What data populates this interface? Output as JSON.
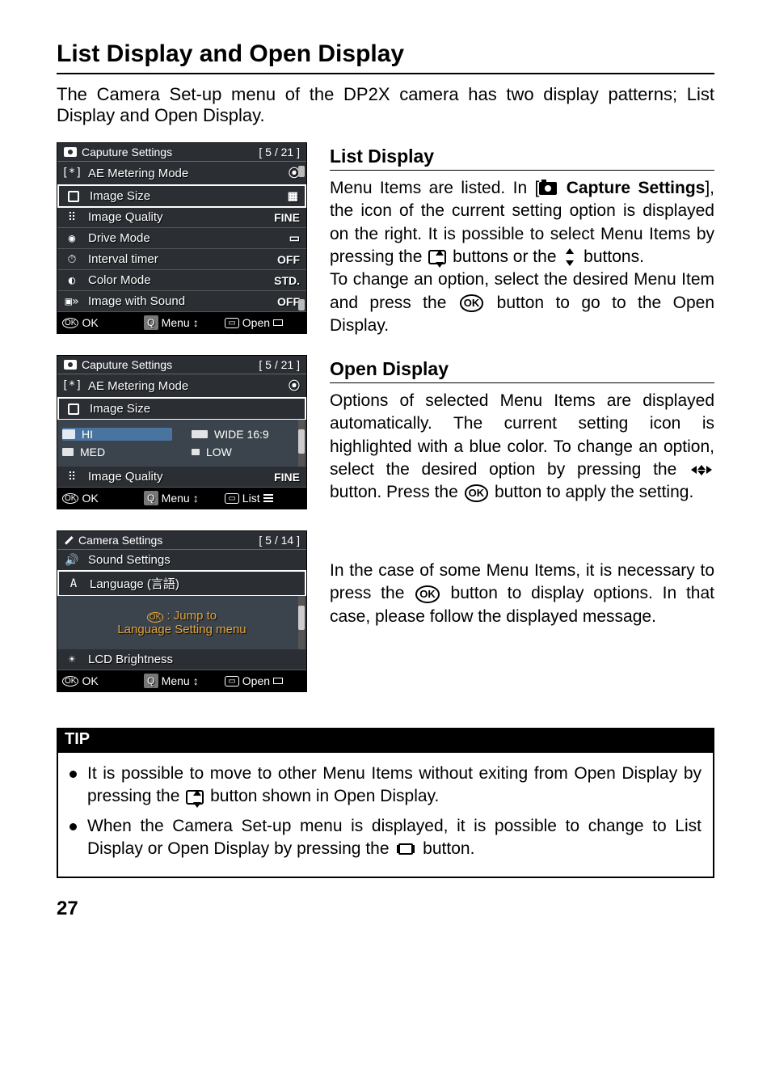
{
  "page_title": "List Display and Open Display",
  "intro": "The Camera Set-up menu of the DP2X camera has two display patterns; List Display and Open Display.",
  "list_display": {
    "heading": "List Display",
    "body1": "Menu Items are listed. In [",
    "body_cap": "Capture Settings",
    "body2": "], the icon of the current setting option is displayed on the right. It is possible to select Menu Items by pressing the ",
    "body3": " buttons or the ",
    "body4": " buttons.",
    "body5": "To change an option, select the desired Menu Item and press the ",
    "body6": " button to go to the Open Display."
  },
  "open_display": {
    "heading": "Open Display",
    "body1": "Options of selected Menu Items are displayed automatically. The current setting icon is highlighted with a blue color. To change an option, select the desired option by pressing the ",
    "body2": "button. Press the ",
    "body3": " button to apply the setting."
  },
  "jump_text": "In the case of some Menu Items, it is necessary to press the ",
  "jump_text2": " button to display options. In that case, please follow the displayed message.",
  "screen1": {
    "title": "Caputure Settings",
    "pager": "[ 5 / 21 ]",
    "items": [
      {
        "label": "AE Metering Mode",
        "val": "⦿"
      },
      {
        "label": "Image Size",
        "val": "▦"
      },
      {
        "label": "Image Quality",
        "val": "FINE"
      },
      {
        "label": "Drive Mode",
        "val": "▭"
      },
      {
        "label": "Interval timer",
        "val": "OFF"
      },
      {
        "label": "Color Mode",
        "val": "STD."
      },
      {
        "label": "Image with Sound",
        "val": "OFF"
      }
    ],
    "footer": {
      "ok": "OK",
      "menu": "Menu",
      "last": "Open"
    }
  },
  "screen2": {
    "title": "Caputure Settings",
    "pager": "[ 5 / 21 ]",
    "items": [
      {
        "label": "AE Metering Mode",
        "val": "⦿"
      },
      {
        "label": "Image Size",
        "val": ""
      }
    ],
    "options": [
      {
        "label": "HI"
      },
      {
        "label": "WIDE 16:9"
      },
      {
        "label": "MED"
      },
      {
        "label": "LOW"
      }
    ],
    "after": {
      "label": "Image Quality",
      "val": "FINE"
    },
    "footer": {
      "ok": "OK",
      "menu": "Menu",
      "last": "List"
    }
  },
  "screen3": {
    "title": "Camera Settings",
    "pager": "[ 5 / 14 ]",
    "items": [
      {
        "label": "Sound Settings"
      },
      {
        "label": "Language (言語)"
      }
    ],
    "msg1": ": Jump to",
    "msg2": "Language Setting menu",
    "after": {
      "label": "LCD Brightness"
    },
    "footer": {
      "ok": "OK",
      "menu": "Menu",
      "last": "Open"
    }
  },
  "tip": {
    "heading": "TIP",
    "items": [
      {
        "a": "It is possible to move to other Menu Items without exiting from Open Display by pressing the ",
        "b": " button shown in Open Display."
      },
      {
        "a": "When the Camera Set-up menu is displayed, it is possible to change to List Display or Open Display by pressing the ",
        "b": " button."
      }
    ]
  },
  "page_number": "27"
}
